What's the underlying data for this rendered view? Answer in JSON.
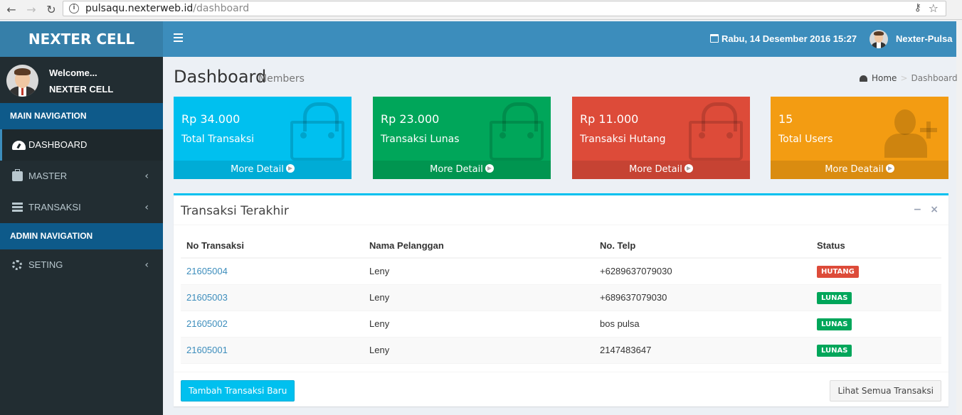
{
  "browser": {
    "url_host": "pulsaqu.nexterweb.id",
    "url_path": "/dashboard",
    "back_icon": "←",
    "forward_icon": "→",
    "reload_icon": "↻",
    "info_icon": "i",
    "key_icon": "⚷",
    "star_icon": "☆"
  },
  "header": {
    "logo": "NEXTER CELL",
    "date": "Rabu, 14 Desember 2016 15:27",
    "user_name": "Nexter-Pulsa"
  },
  "sidebar": {
    "welcome": "Welcome...",
    "shop_name": "NEXTER CELL",
    "main_nav_header": "MAIN NAVIGATION",
    "admin_nav_header": "ADMIN NAVIGATION",
    "items": [
      {
        "label": "DASHBOARD",
        "icon": "dashboard-icon"
      },
      {
        "label": "MASTER",
        "icon": "briefcase-icon"
      },
      {
        "label": "TRANSAKSI",
        "icon": "list-icon"
      },
      {
        "label": "SETING",
        "icon": "gears-icon"
      }
    ],
    "chevron": "‹"
  },
  "content": {
    "title": "Dashboard",
    "subtitle": "Members",
    "breadcrumb_home": "Home",
    "breadcrumb_sep": ">",
    "breadcrumb_current": "Dashboard"
  },
  "boxes": [
    {
      "value": "Rp 34.000",
      "label": "Total Transaksi",
      "footer": "More Detail",
      "color": "#00c0ef"
    },
    {
      "value": "Rp 23.000",
      "label": "Transaksi Lunas",
      "footer": "More Detail",
      "color": "#00a65a"
    },
    {
      "value": "Rp 11.000",
      "label": "Transaksi Hutang",
      "footer": "More Detail",
      "color": "#dd4b39"
    },
    {
      "value": "15",
      "label": "Total Users",
      "footer": "More Deatail",
      "color": "#f39c12"
    }
  ],
  "panel": {
    "title": "Transaksi Terakhir",
    "minimize": "−",
    "close": "×",
    "columns": [
      "No Transaksi",
      "Nama Pelanggan",
      "No. Telp",
      "Status"
    ],
    "rows": [
      {
        "no": "21605004",
        "nama": "Leny",
        "telp": "+6289637079030",
        "status": "HUTANG",
        "status_color": "#dd4b39"
      },
      {
        "no": "21605003",
        "nama": "Leny",
        "telp": "+689637079030",
        "status": "LUNAS",
        "status_color": "#00a65a"
      },
      {
        "no": "21605002",
        "nama": "Leny",
        "telp": "bos pulsa",
        "status": "LUNAS",
        "status_color": "#00a65a"
      },
      {
        "no": "21605001",
        "nama": "Leny",
        "telp": "2147483647",
        "status": "LUNAS",
        "status_color": "#00a65a"
      }
    ],
    "btn_new": "Tambah Transaksi Baru",
    "btn_all": "Lihat Semua Transaksi"
  }
}
